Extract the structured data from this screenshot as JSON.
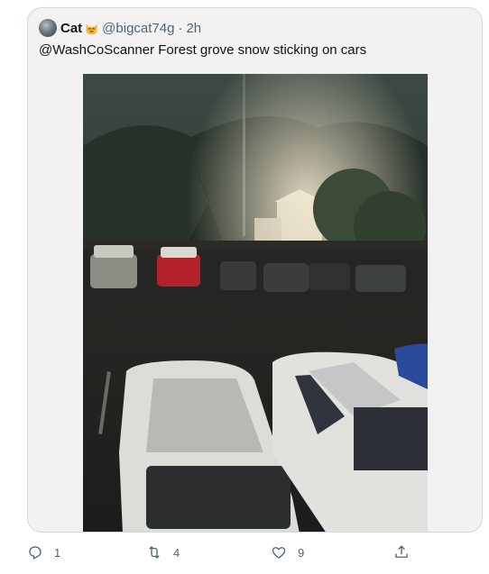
{
  "tweet": {
    "author": {
      "display_name": "Cat",
      "emoji_icon": "smiling-cat-face-icon",
      "handle": "@bigcat74g",
      "separator": "·",
      "time": "2h"
    },
    "text": "@WashCoScanner Forest grove snow sticking on cars",
    "media": {
      "icon": "photo-snow-covered-cars-parking-lot"
    }
  },
  "actions": {
    "reply_count": "1",
    "retweet_count": "4",
    "like_count": "9",
    "share_icon": "share-upload-icon"
  },
  "colors": {
    "card_background": "#f2f2f2",
    "card_border": "#cfd9de",
    "secondary_text": "#536471",
    "primary_text": "#0f1419"
  }
}
